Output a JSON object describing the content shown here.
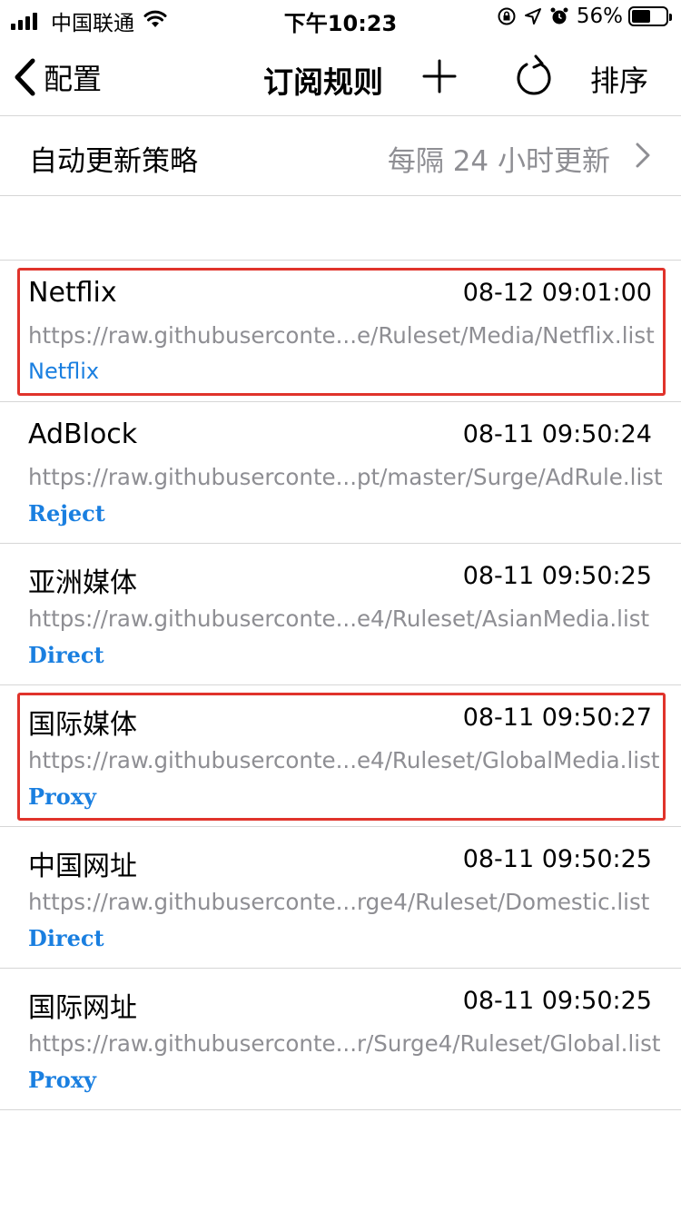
{
  "status_bar": {
    "carrier": "中国联通",
    "time": "下午10:23",
    "battery": "56%",
    "battery_level": 0.56
  },
  "nav": {
    "back_label": "配置",
    "title": "订阅规则",
    "sort_label": "排序"
  },
  "auto_update": {
    "label": "自动更新策略",
    "value": "每隔 24 小时更新"
  },
  "rules": [
    {
      "name": "Netflix",
      "time": "08-12 09:01:00",
      "url": "https://raw.githubuserconte...e/Ruleset/Media/Netflix.list",
      "policy": "Netflix",
      "highlighted": true
    },
    {
      "name": "AdBlock",
      "time": "08-11 09:50:24",
      "url": "https://raw.githubuserconte...pt/master/Surge/AdRule.list",
      "policy": "Reject",
      "highlighted": false
    },
    {
      "name": "亚洲媒体",
      "time": "08-11 09:50:25",
      "url": "https://raw.githubuserconte...e4/Ruleset/AsianMedia.list",
      "policy": "Direct",
      "highlighted": false
    },
    {
      "name": "国际媒体",
      "time": "08-11 09:50:27",
      "url": "https://raw.githubuserconte...e4/Ruleset/GlobalMedia.list",
      "policy": "Proxy",
      "highlighted": true
    },
    {
      "name": "中国网址",
      "time": "08-11 09:50:25",
      "url": "https://raw.githubuserconte...rge4/Ruleset/Domestic.list",
      "policy": "Direct",
      "highlighted": false
    },
    {
      "name": "国际网址",
      "time": "08-11 09:50:25",
      "url": "https://raw.githubuserconte...r/Surge4/Ruleset/Global.list",
      "policy": "Proxy",
      "highlighted": false
    }
  ],
  "colors": {
    "accent": "#1a7fe0",
    "secondary_text": "#8e8e93",
    "highlight_border": "#e0332b"
  }
}
